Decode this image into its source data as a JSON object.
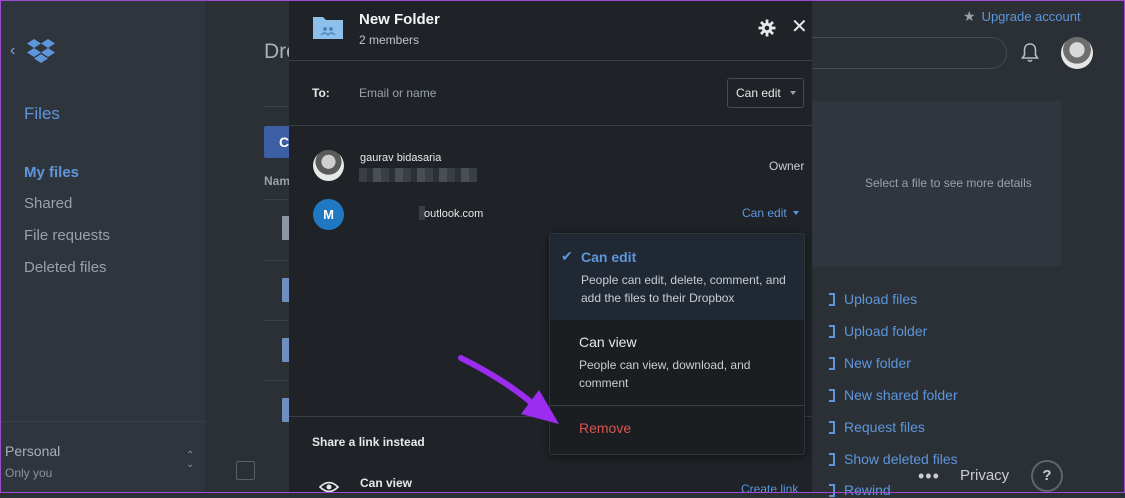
{
  "sidebar": {
    "section_title": "Files",
    "items": [
      {
        "label": "My files",
        "active": true
      },
      {
        "label": "Shared",
        "active": false
      },
      {
        "label": "File requests",
        "active": false
      },
      {
        "label": "Deleted files",
        "active": false
      }
    ],
    "plan": {
      "name": "Personal",
      "subtitle": "Only you"
    }
  },
  "main": {
    "title_fragment": "Dro",
    "create_fragment": "C",
    "column_fragment": "Nam"
  },
  "topbar": {
    "upgrade_label": "Upgrade account"
  },
  "details": {
    "placeholder": "Select a file to see more details"
  },
  "actions": [
    {
      "label": "Upload files"
    },
    {
      "label": "Upload folder"
    },
    {
      "label": "New folder"
    },
    {
      "label": "New shared folder"
    },
    {
      "label": "Request files"
    },
    {
      "label": "Show deleted files"
    },
    {
      "label": "Rewind"
    }
  ],
  "footer": {
    "privacy_label": "Privacy",
    "more_label": "•••",
    "help_label": "?"
  },
  "modal": {
    "title": "New Folder",
    "subtitle": "2 members",
    "to_label": "To:",
    "to_placeholder": "Email or name",
    "invite_permission": "Can edit",
    "members": [
      {
        "name": "gaurav bidasaria",
        "role": "Owner"
      },
      {
        "avatar_letter": "M",
        "email": "outlook.com",
        "role": "Can edit"
      }
    ],
    "share_section_title": "Share a link instead",
    "link_permission": "Can view",
    "create_link_label": "Create link"
  },
  "dropdown": {
    "options": [
      {
        "title": "Can edit",
        "description": "People can edit, delete, comment, and add the files to their Dropbox",
        "selected": true
      },
      {
        "title": "Can view",
        "description": "People can view, download, and comment",
        "selected": false
      }
    ],
    "remove_label": "Remove"
  },
  "colors": {
    "accent": "#5e96dc",
    "danger": "#d9534f",
    "annotation_arrow": "#9b2cf0"
  }
}
